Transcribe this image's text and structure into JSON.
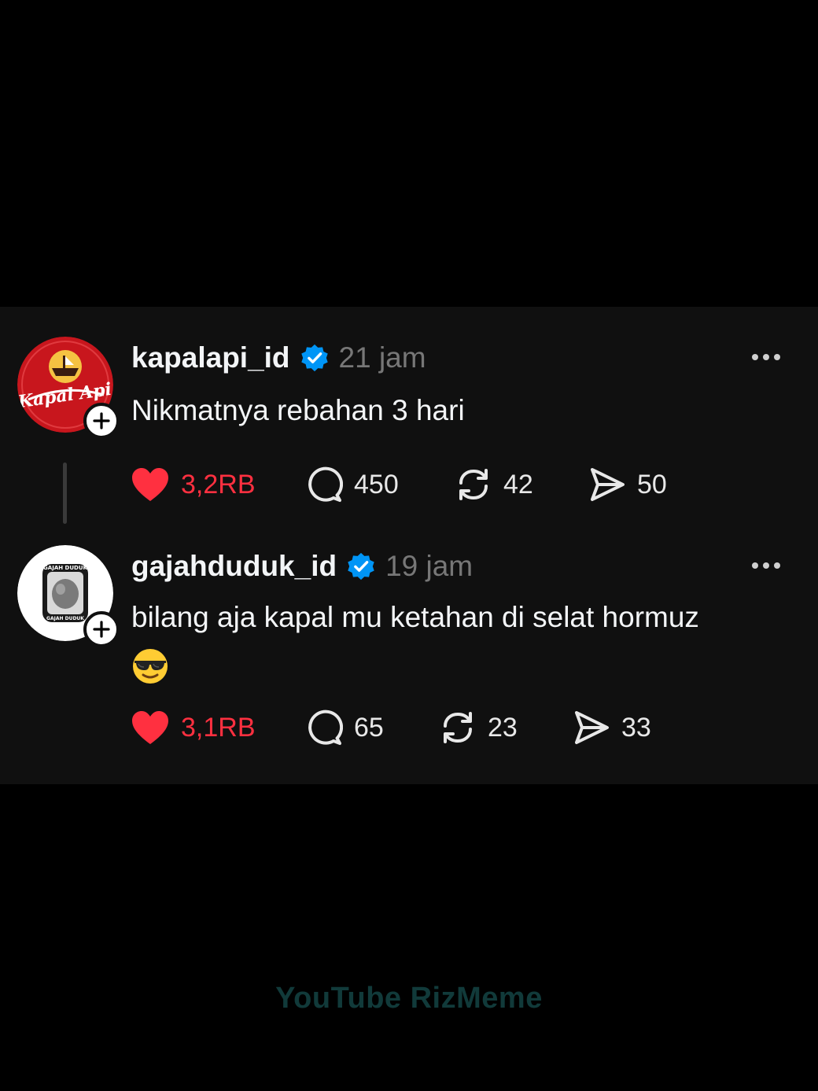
{
  "posts": [
    {
      "username": "kapalapi_id",
      "verified": true,
      "time": "21 jam",
      "text": "Nikmatnya rebahan 3 hari",
      "emoji": null,
      "avatar_logo_text": "Kapal Api",
      "likes": "3,2RB",
      "liked": true,
      "replies": "450",
      "reposts": "42",
      "shares": "50"
    },
    {
      "username": "gajahduduk_id",
      "verified": true,
      "time": "19 jam",
      "text": "bilang aja kapal mu ketahan di selat hormuz",
      "emoji": "smiling-face-with-sunglasses",
      "avatar_logo_text": "GAJAH DUDUK",
      "likes": "3,1RB",
      "liked": true,
      "replies": "65",
      "reposts": "23",
      "shares": "33"
    }
  ],
  "icons": {
    "like": "heart-icon",
    "reply": "comment-icon",
    "repost": "repost-icon",
    "share": "send-icon",
    "more": "more-icon",
    "verified": "verified-badge-icon",
    "follow": "plus-icon"
  },
  "colors": {
    "background": "#000000",
    "card": "#101010",
    "like_active": "#ff3040",
    "verified": "#0095f6",
    "muted": "#777777",
    "watermark": "#113a3a"
  },
  "watermark": "YouTube  RizMeme"
}
